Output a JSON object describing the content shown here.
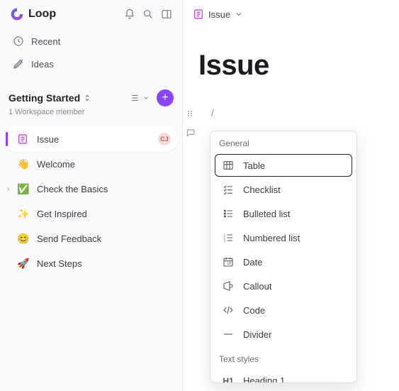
{
  "brand": "Loop",
  "nav": {
    "recent": "Recent",
    "ideas": "Ideas"
  },
  "section": {
    "title": "Getting Started",
    "subtitle": "1 Workspace member"
  },
  "pages": [
    {
      "label": "Issue",
      "avatar": "CJ"
    },
    {
      "label": "Welcome"
    },
    {
      "label": "Check the Basics"
    },
    {
      "label": "Get Inspired"
    },
    {
      "label": "Send Feedback"
    },
    {
      "label": "Next Steps"
    }
  ],
  "main": {
    "breadcrumb": "Issue",
    "title": "Issue",
    "slash": "/"
  },
  "menu": {
    "group1": "General",
    "items1": [
      {
        "label": "Table"
      },
      {
        "label": "Checklist"
      },
      {
        "label": "Bulleted list"
      },
      {
        "label": "Numbered list"
      },
      {
        "label": "Date"
      },
      {
        "label": "Callout"
      },
      {
        "label": "Code"
      },
      {
        "label": "Divider"
      }
    ],
    "group2": "Text styles",
    "items2": [
      {
        "label": "Heading 1"
      }
    ]
  }
}
